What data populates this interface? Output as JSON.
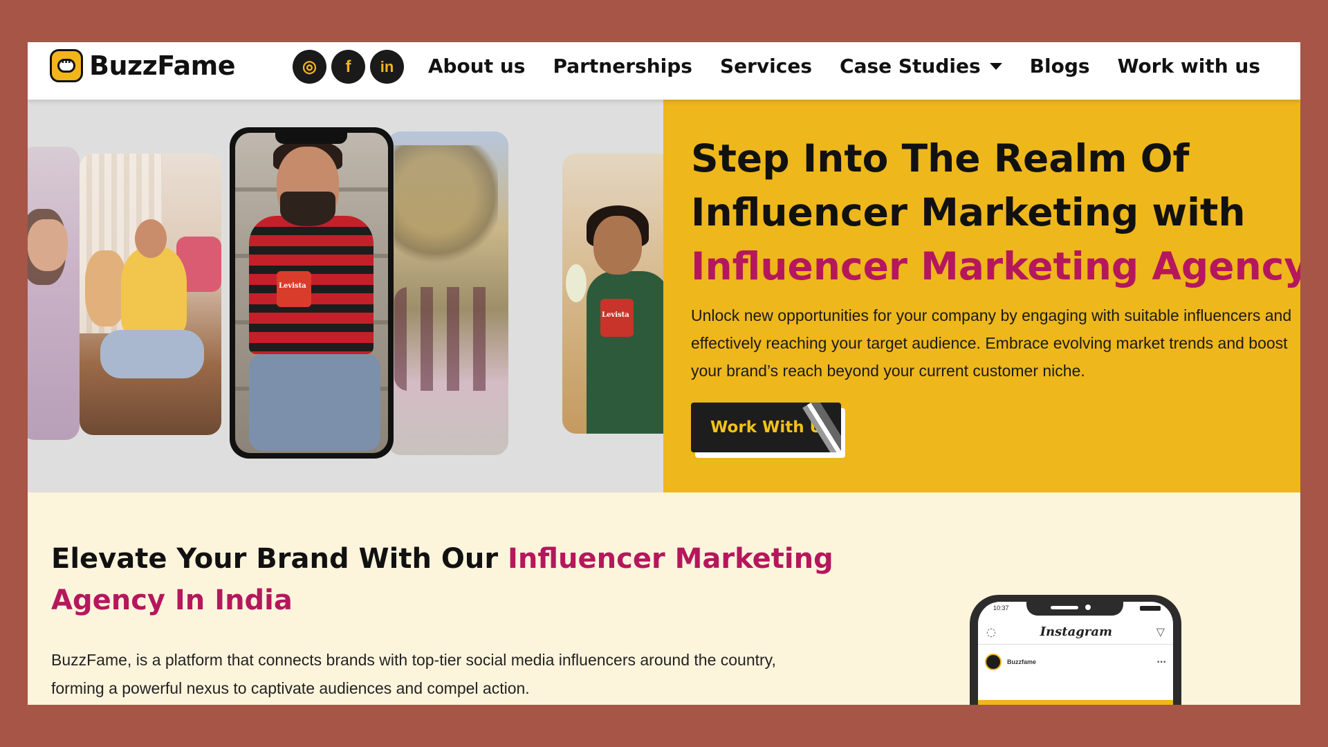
{
  "brand": {
    "name": "BuzzFame"
  },
  "socials": [
    {
      "name": "instagram",
      "glyph": "◎"
    },
    {
      "name": "facebook",
      "glyph": "f"
    },
    {
      "name": "linkedin",
      "glyph": "in"
    }
  ],
  "nav": {
    "about": "About us",
    "partnerships": "Partnerships",
    "services": "Services",
    "case_studies": "Case Studies",
    "blogs": "Blogs",
    "work": "Work with us"
  },
  "hero": {
    "title_line1": "Step Into The Realm Of",
    "title_line2": "Influencer Marketing with",
    "title_accent": "Influencer Marketing Agency!",
    "body_line1": "Unlock new opportunities for your company by engaging with suitable influencers and",
    "body_line2": "effectively reaching your target audience. Embrace evolving market trends and boost",
    "body_line3": "your brand’s reach beyond your current customer niche.",
    "cta": "Work With Us",
    "mug_label": "Levista"
  },
  "section": {
    "title_plain": "Elevate Your Brand With Our ",
    "title_accent_1": "Influencer Marketing",
    "title_accent_2": "Agency In India",
    "body_line1": "BuzzFame, is a platform that connects brands with top-tier social media influencers around the country,",
    "body_line2": "forming a powerful nexus to captivate audiences and compel action."
  },
  "phone": {
    "time": "10:37",
    "app_title": "Instagram",
    "post_user": "Buzzfame",
    "more": "···",
    "camera_icon": "◌",
    "send_icon": "▽"
  },
  "colors": {
    "page_border": "#a65546",
    "brand_yellow": "#eeb71b",
    "accent_magenta": "#b5175d",
    "section_bg": "#fdf4dc"
  }
}
